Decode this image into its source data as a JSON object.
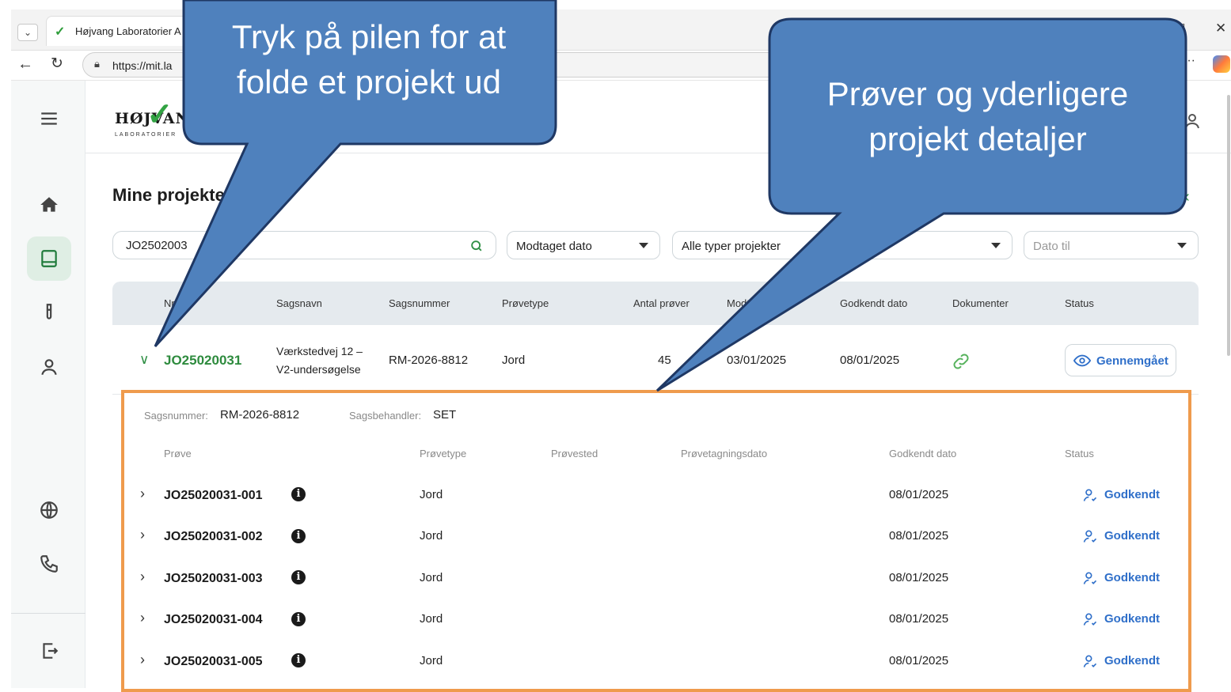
{
  "browser": {
    "tab_title": "Højvang Laboratorier A",
    "url": "https://mit.la"
  },
  "brand": {
    "logo_word": "HØJVAN",
    "logo_sub": "LABORATORIER",
    "accent": "#2e8b3e",
    "link_blue": "#2f6fc9",
    "highlight": "#ef9b4d"
  },
  "nav": {
    "items": [
      "menu-icon",
      "home-icon",
      "projects-icon",
      "flask-icon",
      "user-icon",
      "globe-icon",
      "phone-icon",
      "logout-icon"
    ],
    "active": "projects-icon"
  },
  "page": {
    "title": "Mine projekter"
  },
  "filters": {
    "search_value": "JO2502003",
    "received_date": "Modtaget dato",
    "project_type": "Alle typer projekter",
    "date_to_placeholder": "Dato til"
  },
  "table": {
    "headers": {
      "nr": "Nr",
      "case_name": "Sagsnavn",
      "case_no": "Sagsnummer",
      "sample_type": "Prøvetype",
      "count": "Antal prøver",
      "received": "Modtaget dato",
      "approved": "Godkendt dato",
      "documents": "Dokumenter",
      "status": "Status"
    },
    "row": {
      "nr": "JO25020031",
      "case_name_1": "Værkstedvej 12 –",
      "case_name_2": "V2-undersøgelse",
      "case_no": "RM-2026-8812",
      "sample_type": "Jord",
      "count": "45",
      "received": "03/01/2025",
      "approved": "08/01/2025",
      "status": "Gennemgået"
    }
  },
  "details": {
    "case_no_label": "Sagsnummer:",
    "case_no": "RM-2026-8812",
    "handler_label": "Sagsbehandler:",
    "handler": "SET",
    "headers": {
      "sample": "Prøve",
      "type": "Prøvetype",
      "location": "Prøvested",
      "sampling_date": "Prøvetagningsdato",
      "approved": "Godkendt dato",
      "status": "Status"
    },
    "samples": [
      {
        "id": "JO25020031-001",
        "type": "Jord",
        "approved": "08/01/2025",
        "status": "Godkendt"
      },
      {
        "id": "JO25020031-002",
        "type": "Jord",
        "approved": "08/01/2025",
        "status": "Godkendt"
      },
      {
        "id": "JO25020031-003",
        "type": "Jord",
        "approved": "08/01/2025",
        "status": "Godkendt"
      },
      {
        "id": "JO25020031-004",
        "type": "Jord",
        "approved": "08/01/2025",
        "status": "Godkendt"
      },
      {
        "id": "JO25020031-005",
        "type": "Jord",
        "approved": "08/01/2025",
        "status": "Godkendt"
      }
    ]
  },
  "callouts": {
    "left_line1": "Tryk på pilen for at",
    "left_line2": "folde et projekt ud",
    "right_line1": "Prøver og yderligere",
    "right_line2": "projekt detaljer",
    "fill": "#4f81bd",
    "stroke": "#1f3864"
  }
}
